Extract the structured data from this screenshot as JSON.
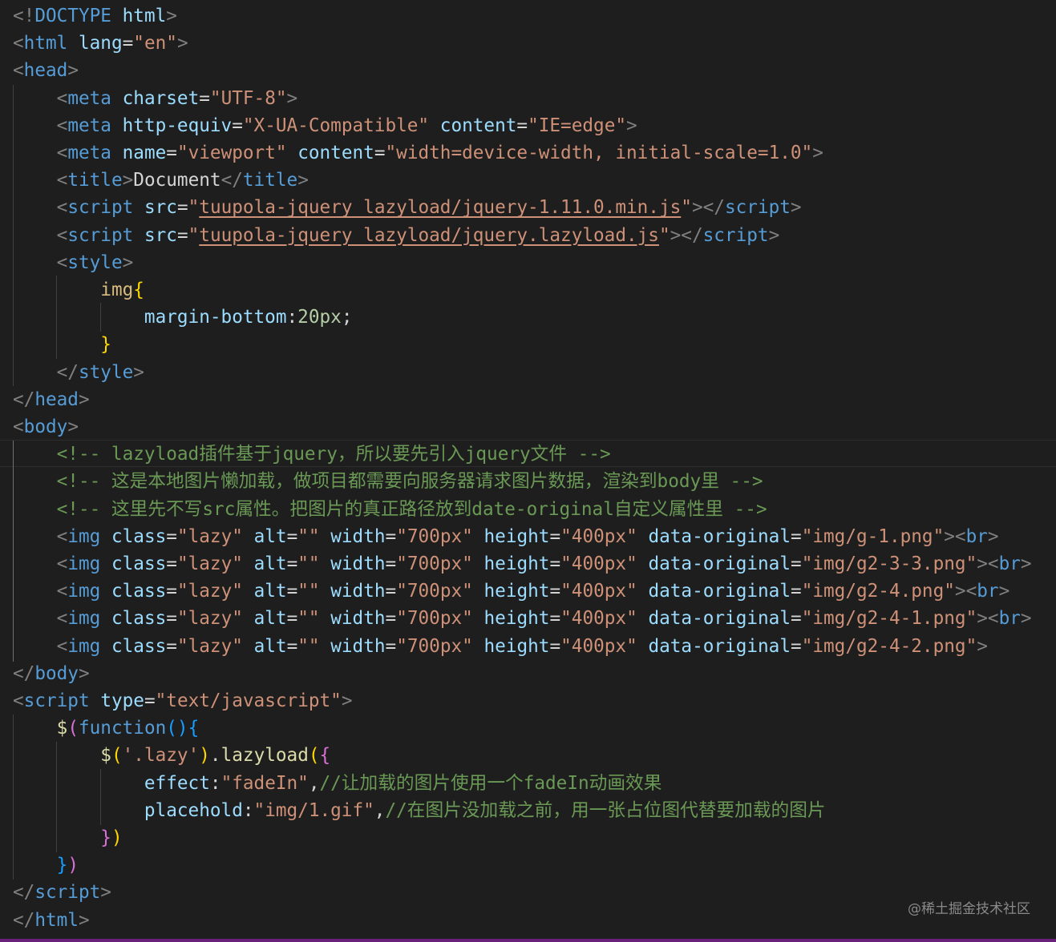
{
  "editor": {
    "lines": [
      [
        [
          "p",
          "<!"
        ],
        [
          "t",
          "DOCTYPE"
        ],
        [
          "o",
          " "
        ],
        [
          "a",
          "html"
        ],
        [
          "p",
          ">"
        ]
      ],
      [
        [
          "p",
          "<"
        ],
        [
          "t",
          "html"
        ],
        [
          "o",
          " "
        ],
        [
          "a",
          "lang"
        ],
        [
          "o",
          "="
        ],
        [
          "s",
          "\"en\""
        ],
        [
          "p",
          ">"
        ]
      ],
      [
        [
          "p",
          "<"
        ],
        [
          "t",
          "head"
        ],
        [
          "p",
          ">"
        ]
      ],
      [
        [
          "o",
          "    "
        ],
        [
          "p",
          "<"
        ],
        [
          "t",
          "meta"
        ],
        [
          "o",
          " "
        ],
        [
          "a",
          "charset"
        ],
        [
          "o",
          "="
        ],
        [
          "s",
          "\"UTF-8\""
        ],
        [
          "p",
          ">"
        ]
      ],
      [
        [
          "o",
          "    "
        ],
        [
          "p",
          "<"
        ],
        [
          "t",
          "meta"
        ],
        [
          "o",
          " "
        ],
        [
          "a",
          "http-equiv"
        ],
        [
          "o",
          "="
        ],
        [
          "s",
          "\"X-UA-Compatible\""
        ],
        [
          "o",
          " "
        ],
        [
          "a",
          "content"
        ],
        [
          "o",
          "="
        ],
        [
          "s",
          "\"IE=edge\""
        ],
        [
          "p",
          ">"
        ]
      ],
      [
        [
          "o",
          "    "
        ],
        [
          "p",
          "<"
        ],
        [
          "t",
          "meta"
        ],
        [
          "o",
          " "
        ],
        [
          "a",
          "name"
        ],
        [
          "o",
          "="
        ],
        [
          "s",
          "\"viewport\""
        ],
        [
          "o",
          " "
        ],
        [
          "a",
          "content"
        ],
        [
          "o",
          "="
        ],
        [
          "s",
          "\"width=device-width, initial-scale=1.0\""
        ],
        [
          "p",
          ">"
        ]
      ],
      [
        [
          "o",
          "    "
        ],
        [
          "p",
          "<"
        ],
        [
          "t",
          "title"
        ],
        [
          "p",
          ">"
        ],
        [
          "o",
          "Document"
        ],
        [
          "p",
          "</"
        ],
        [
          "t",
          "title"
        ],
        [
          "p",
          ">"
        ]
      ],
      [
        [
          "o",
          "    "
        ],
        [
          "p",
          "<"
        ],
        [
          "t",
          "script"
        ],
        [
          "o",
          " "
        ],
        [
          "a",
          "src"
        ],
        [
          "o",
          "="
        ],
        [
          "s",
          "\""
        ],
        [
          "s u",
          "tuupola-jquery_lazyload/jquery-1.11.0.min.js"
        ],
        [
          "s",
          "\""
        ],
        [
          "p",
          "></"
        ],
        [
          "t",
          "script"
        ],
        [
          "p",
          ">"
        ]
      ],
      [
        [
          "o",
          "    "
        ],
        [
          "p",
          "<"
        ],
        [
          "t",
          "script"
        ],
        [
          "o",
          " "
        ],
        [
          "a",
          "src"
        ],
        [
          "o",
          "="
        ],
        [
          "s",
          "\""
        ],
        [
          "s u",
          "tuupola-jquery_lazyload/jquery.lazyload.js"
        ],
        [
          "s",
          "\""
        ],
        [
          "p",
          "></"
        ],
        [
          "t",
          "script"
        ],
        [
          "p",
          ">"
        ]
      ],
      [
        [
          "o",
          "    "
        ],
        [
          "p",
          "<"
        ],
        [
          "t",
          "style"
        ],
        [
          "p",
          ">"
        ]
      ],
      [
        [
          "o",
          "        "
        ],
        [
          "sel",
          "img"
        ],
        [
          "b1",
          "{"
        ]
      ],
      [
        [
          "o",
          "            "
        ],
        [
          "pr",
          "margin-bottom"
        ],
        [
          "o",
          ":"
        ],
        [
          "num",
          "20px"
        ],
        [
          "o",
          ";"
        ]
      ],
      [
        [
          "o",
          "        "
        ],
        [
          "b1",
          "}"
        ]
      ],
      [
        [
          "o",
          "    "
        ],
        [
          "p",
          "</"
        ],
        [
          "t",
          "style"
        ],
        [
          "p",
          ">"
        ]
      ],
      [
        [
          "p",
          "</"
        ],
        [
          "t",
          "head"
        ],
        [
          "p",
          ">"
        ]
      ],
      [
        [
          "p",
          "<"
        ],
        [
          "t",
          "body"
        ],
        [
          "p",
          ">"
        ]
      ],
      [
        [
          "o",
          "    "
        ],
        [
          "c",
          "<!-- lazyload插件基于jquery，所以要先引入jquery文件 -->"
        ]
      ],
      [
        [
          "o",
          "    "
        ],
        [
          "c",
          "<!-- 这是本地图片懒加载，做项目都需要向服务器请求图片数据，渲染到body里 -->"
        ]
      ],
      [
        [
          "o",
          "    "
        ],
        [
          "c",
          "<!-- 这里先不写src属性。把图片的真正路径放到date-original自定义属性里 -->"
        ]
      ],
      [
        [
          "o",
          "    "
        ],
        [
          "p",
          "<"
        ],
        [
          "t",
          "img"
        ],
        [
          "o",
          " "
        ],
        [
          "a",
          "class"
        ],
        [
          "o",
          "="
        ],
        [
          "s",
          "\"lazy\""
        ],
        [
          "o",
          " "
        ],
        [
          "a",
          "alt"
        ],
        [
          "o",
          "="
        ],
        [
          "s",
          "\"\""
        ],
        [
          "o",
          " "
        ],
        [
          "a",
          "width"
        ],
        [
          "o",
          "="
        ],
        [
          "s",
          "\"700px\""
        ],
        [
          "o",
          " "
        ],
        [
          "a",
          "height"
        ],
        [
          "o",
          "="
        ],
        [
          "s",
          "\"400px\""
        ],
        [
          "o",
          " "
        ],
        [
          "a",
          "data-original"
        ],
        [
          "o",
          "="
        ],
        [
          "s",
          "\"img/g-1.png\""
        ],
        [
          "p",
          "><"
        ],
        [
          "t",
          "br"
        ],
        [
          "p",
          ">"
        ]
      ],
      [
        [
          "o",
          "    "
        ],
        [
          "p",
          "<"
        ],
        [
          "t",
          "img"
        ],
        [
          "o",
          " "
        ],
        [
          "a",
          "class"
        ],
        [
          "o",
          "="
        ],
        [
          "s",
          "\"lazy\""
        ],
        [
          "o",
          " "
        ],
        [
          "a",
          "alt"
        ],
        [
          "o",
          "="
        ],
        [
          "s",
          "\"\""
        ],
        [
          "o",
          " "
        ],
        [
          "a",
          "width"
        ],
        [
          "o",
          "="
        ],
        [
          "s",
          "\"700px\""
        ],
        [
          "o",
          " "
        ],
        [
          "a",
          "height"
        ],
        [
          "o",
          "="
        ],
        [
          "s",
          "\"400px\""
        ],
        [
          "o",
          " "
        ],
        [
          "a",
          "data-original"
        ],
        [
          "o",
          "="
        ],
        [
          "s",
          "\"img/g2-3-3.png\""
        ],
        [
          "p",
          "><"
        ],
        [
          "t",
          "br"
        ],
        [
          "p",
          ">"
        ]
      ],
      [
        [
          "o",
          "    "
        ],
        [
          "p",
          "<"
        ],
        [
          "t",
          "img"
        ],
        [
          "o",
          " "
        ],
        [
          "a",
          "class"
        ],
        [
          "o",
          "="
        ],
        [
          "s",
          "\"lazy\""
        ],
        [
          "o",
          " "
        ],
        [
          "a",
          "alt"
        ],
        [
          "o",
          "="
        ],
        [
          "s",
          "\"\""
        ],
        [
          "o",
          " "
        ],
        [
          "a",
          "width"
        ],
        [
          "o",
          "="
        ],
        [
          "s",
          "\"700px\""
        ],
        [
          "o",
          " "
        ],
        [
          "a",
          "height"
        ],
        [
          "o",
          "="
        ],
        [
          "s",
          "\"400px\""
        ],
        [
          "o",
          " "
        ],
        [
          "a",
          "data-original"
        ],
        [
          "o",
          "="
        ],
        [
          "s",
          "\"img/g2-4.png\""
        ],
        [
          "p",
          "><"
        ],
        [
          "t",
          "br"
        ],
        [
          "p",
          ">"
        ]
      ],
      [
        [
          "o",
          "    "
        ],
        [
          "p",
          "<"
        ],
        [
          "t",
          "img"
        ],
        [
          "o",
          " "
        ],
        [
          "a",
          "class"
        ],
        [
          "o",
          "="
        ],
        [
          "s",
          "\"lazy\""
        ],
        [
          "o",
          " "
        ],
        [
          "a",
          "alt"
        ],
        [
          "o",
          "="
        ],
        [
          "s",
          "\"\""
        ],
        [
          "o",
          " "
        ],
        [
          "a",
          "width"
        ],
        [
          "o",
          "="
        ],
        [
          "s",
          "\"700px\""
        ],
        [
          "o",
          " "
        ],
        [
          "a",
          "height"
        ],
        [
          "o",
          "="
        ],
        [
          "s",
          "\"400px\""
        ],
        [
          "o",
          " "
        ],
        [
          "a",
          "data-original"
        ],
        [
          "o",
          "="
        ],
        [
          "s",
          "\"img/g2-4-1.png\""
        ],
        [
          "p",
          "><"
        ],
        [
          "t",
          "br"
        ],
        [
          "p",
          ">"
        ]
      ],
      [
        [
          "o",
          "    "
        ],
        [
          "p",
          "<"
        ],
        [
          "t",
          "img"
        ],
        [
          "o",
          " "
        ],
        [
          "a",
          "class"
        ],
        [
          "o",
          "="
        ],
        [
          "s",
          "\"lazy\""
        ],
        [
          "o",
          " "
        ],
        [
          "a",
          "alt"
        ],
        [
          "o",
          "="
        ],
        [
          "s",
          "\"\""
        ],
        [
          "o",
          " "
        ],
        [
          "a",
          "width"
        ],
        [
          "o",
          "="
        ],
        [
          "s",
          "\"700px\""
        ],
        [
          "o",
          " "
        ],
        [
          "a",
          "height"
        ],
        [
          "o",
          "="
        ],
        [
          "s",
          "\"400px\""
        ],
        [
          "o",
          " "
        ],
        [
          "a",
          "data-original"
        ],
        [
          "o",
          "="
        ],
        [
          "s",
          "\"img/g2-4-2.png\""
        ],
        [
          "p",
          ">"
        ]
      ],
      [
        [
          "p",
          "</"
        ],
        [
          "t",
          "body"
        ],
        [
          "p",
          ">"
        ]
      ],
      [
        [
          "p",
          "<"
        ],
        [
          "t",
          "script"
        ],
        [
          "o",
          " "
        ],
        [
          "a",
          "type"
        ],
        [
          "o",
          "="
        ],
        [
          "s",
          "\"text/javascript\""
        ],
        [
          "p",
          ">"
        ]
      ],
      [
        [
          "o",
          "    "
        ],
        [
          "fn",
          "$"
        ],
        [
          "b2",
          "("
        ],
        [
          "kw",
          "function"
        ],
        [
          "b3",
          "()"
        ],
        [
          "b3",
          "{"
        ]
      ],
      [
        [
          "o",
          "        "
        ],
        [
          "fn",
          "$"
        ],
        [
          "b1",
          "("
        ],
        [
          "s",
          "'.lazy'"
        ],
        [
          "b1",
          ")"
        ],
        [
          "o",
          "."
        ],
        [
          "fn",
          "lazyload"
        ],
        [
          "b1",
          "("
        ],
        [
          "b2",
          "{"
        ]
      ],
      [
        [
          "o",
          "            "
        ],
        [
          "pr",
          "effect"
        ],
        [
          "o",
          ":"
        ],
        [
          "s",
          "\"fadeIn\""
        ],
        [
          "o",
          ","
        ],
        [
          "c",
          "//让加载的图片使用一个fadeIn动画效果"
        ]
      ],
      [
        [
          "o",
          "            "
        ],
        [
          "pr",
          "placehold"
        ],
        [
          "o",
          ":"
        ],
        [
          "s",
          "\"img/1.gif\""
        ],
        [
          "o",
          ","
        ],
        [
          "c",
          "//在图片没加载之前，用一张占位图代替要加载的图片"
        ]
      ],
      [
        [
          "o",
          "        "
        ],
        [
          "b2",
          "}"
        ],
        [
          "b1",
          ")"
        ]
      ],
      [
        [
          "o",
          "    "
        ],
        [
          "b3",
          "}"
        ],
        [
          "b2",
          ")"
        ]
      ],
      [
        [
          "p",
          "</"
        ],
        [
          "t",
          "script"
        ],
        [
          "p",
          ">"
        ]
      ],
      [
        [
          "p",
          "</"
        ],
        [
          "t",
          "html"
        ],
        [
          "p",
          ">"
        ]
      ]
    ]
  },
  "watermark": {
    "text": "@稀土掘金技术社区"
  }
}
